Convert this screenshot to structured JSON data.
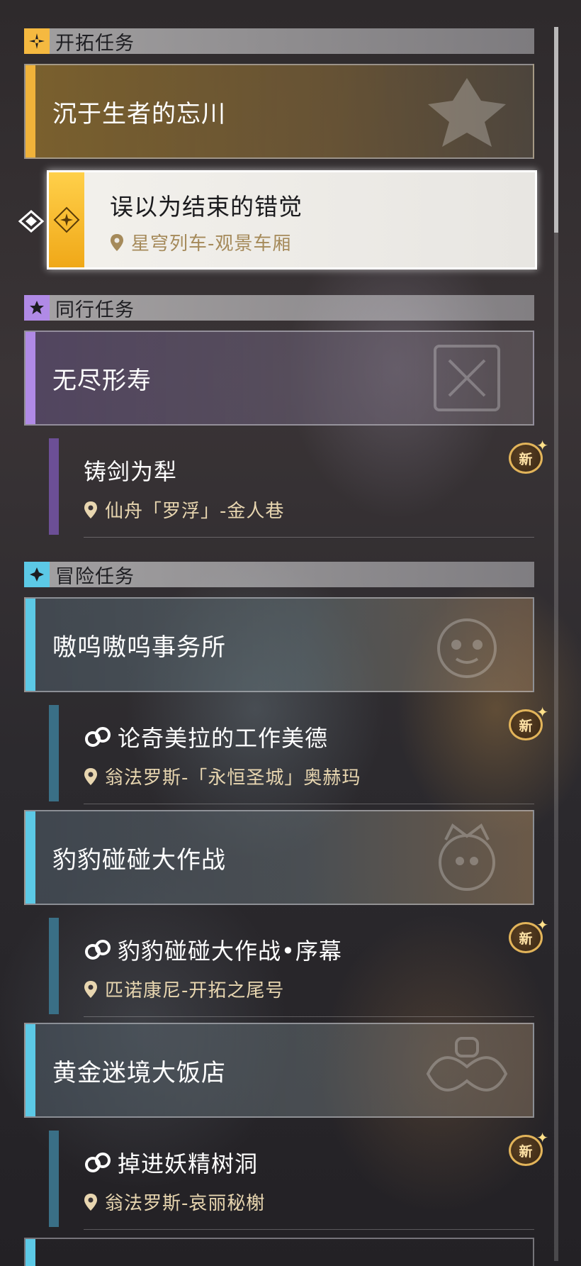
{
  "sections": {
    "trailblaze": {
      "label": "开拓任务",
      "icon": "trailblaze-icon"
    },
    "companion": {
      "label": "同行任务",
      "icon": "star-icon"
    },
    "adventure": {
      "label": "冒险任务",
      "icon": "diamond-sparkle-icon"
    }
  },
  "trailblaze_quest": {
    "title": "沉于生者的忘川",
    "accent_color": "#f0b33a",
    "selected_sub": {
      "title": "误以为结束的错觉",
      "location": "星穹列车-观景车厢"
    }
  },
  "companion_quest": {
    "title": "无尽形寿",
    "accent_color": "#b08ae6",
    "sub": {
      "title": "铸剑为犁",
      "location": "仙舟「罗浮」-金人巷",
      "badge": "新"
    }
  },
  "adventure_quests": [
    {
      "title": "嗷呜嗷呜事务所",
      "sub": {
        "title": "论奇美拉的工作美德",
        "location": "翁法罗斯-「永恒圣城」奥赫玛",
        "badge": "新"
      }
    },
    {
      "title": "豹豹碰碰大作战",
      "sub": {
        "title": "豹豹碰碰大作战•序幕",
        "location": "匹诺康尼-开拓之尾号",
        "badge": "新"
      }
    },
    {
      "title": "黄金迷境大饭店",
      "sub": {
        "title": "掉进妖精树洞",
        "location": "翁法罗斯-哀丽秘榭",
        "badge": "新"
      }
    }
  ],
  "colors": {
    "adventure_accent": "#5cc9e6",
    "sub_bar": "#3a6f86",
    "companion_sub_bar": "#6c4f96"
  }
}
